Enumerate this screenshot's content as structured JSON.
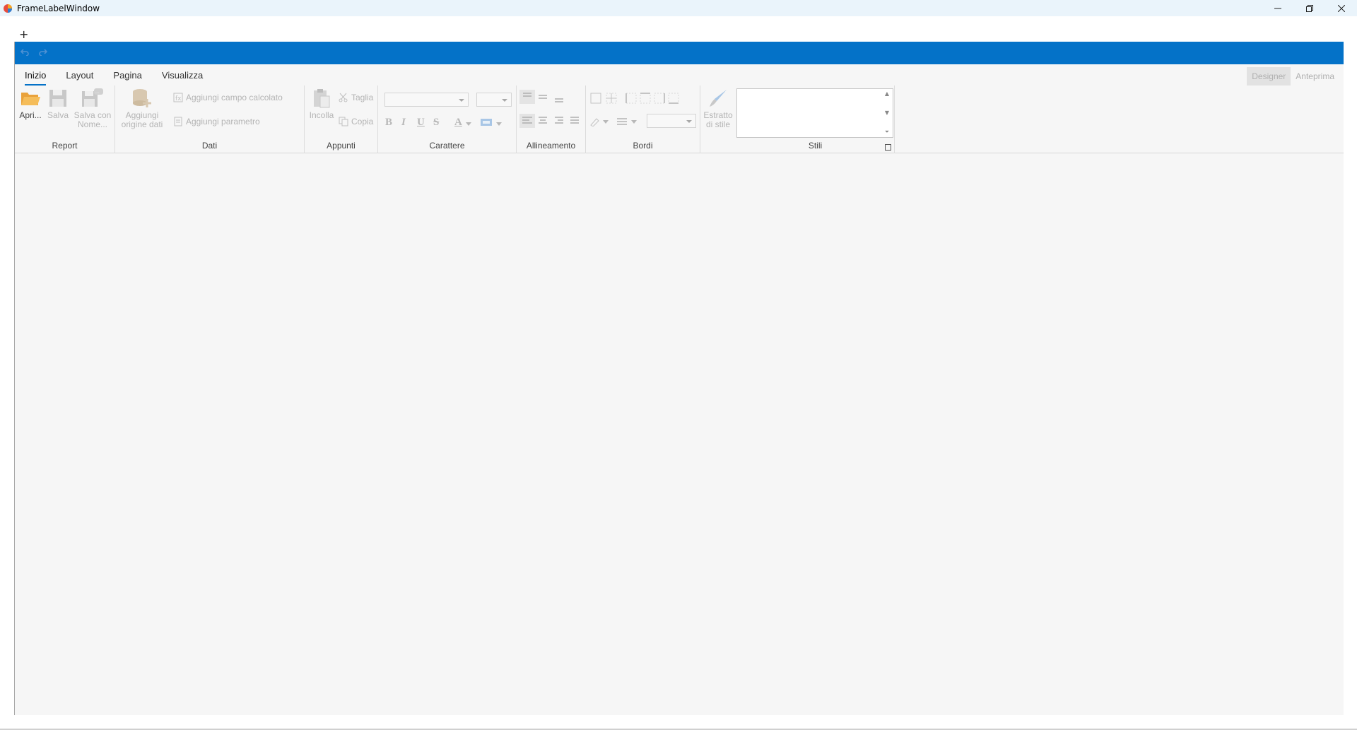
{
  "window": {
    "title": "FrameLabelWindow",
    "minimize_icon": "minimize-icon",
    "restore_icon": "restore-icon",
    "close_icon": "close-icon"
  },
  "toolbar": {
    "add_label": "+",
    "undo_icon": "undo-icon",
    "redo_icon": "redo-icon"
  },
  "ribbon": {
    "tabs": [
      {
        "label": "Inizio",
        "active": true
      },
      {
        "label": "Layout",
        "active": false
      },
      {
        "label": "Pagina",
        "active": false
      },
      {
        "label": "Visualizza",
        "active": false
      }
    ],
    "view_modes": {
      "designer": "Designer",
      "preview": "Anteprima",
      "active": "Designer"
    },
    "groups": {
      "report": {
        "label": "Report",
        "open": "Apri...",
        "save": "Salva",
        "save_as_line1": "Salva con",
        "save_as_line2": "Nome..."
      },
      "data": {
        "label": "Dati",
        "add_datasource_line1": "Aggiungi",
        "add_datasource_line2": "origine dati",
        "add_calculated_field": "Aggiungi campo calcolato",
        "add_parameter": "Aggiungi parametro"
      },
      "clipboard": {
        "label": "Appunti",
        "paste": "Incolla",
        "cut": "Taglia",
        "copy": "Copia"
      },
      "font": {
        "label": "Carattere",
        "font_family_value": "",
        "font_size_value": "",
        "bold": "B",
        "italic": "I",
        "underline": "U",
        "strikethrough": "S",
        "font_color": "A"
      },
      "alignment": {
        "label": "Allineamento"
      },
      "borders": {
        "label": "Bordi",
        "border_width_value": ""
      },
      "style_extract": {
        "line1": "Estratto",
        "line2": "di stile"
      },
      "styles": {
        "label": "Stili"
      }
    }
  },
  "colors": {
    "accent": "#0472c8",
    "titlebar": "#eaf4fb",
    "background": "#f6f6f6",
    "disabled_text": "#b4b4b4",
    "folder": "#f2b04a"
  }
}
